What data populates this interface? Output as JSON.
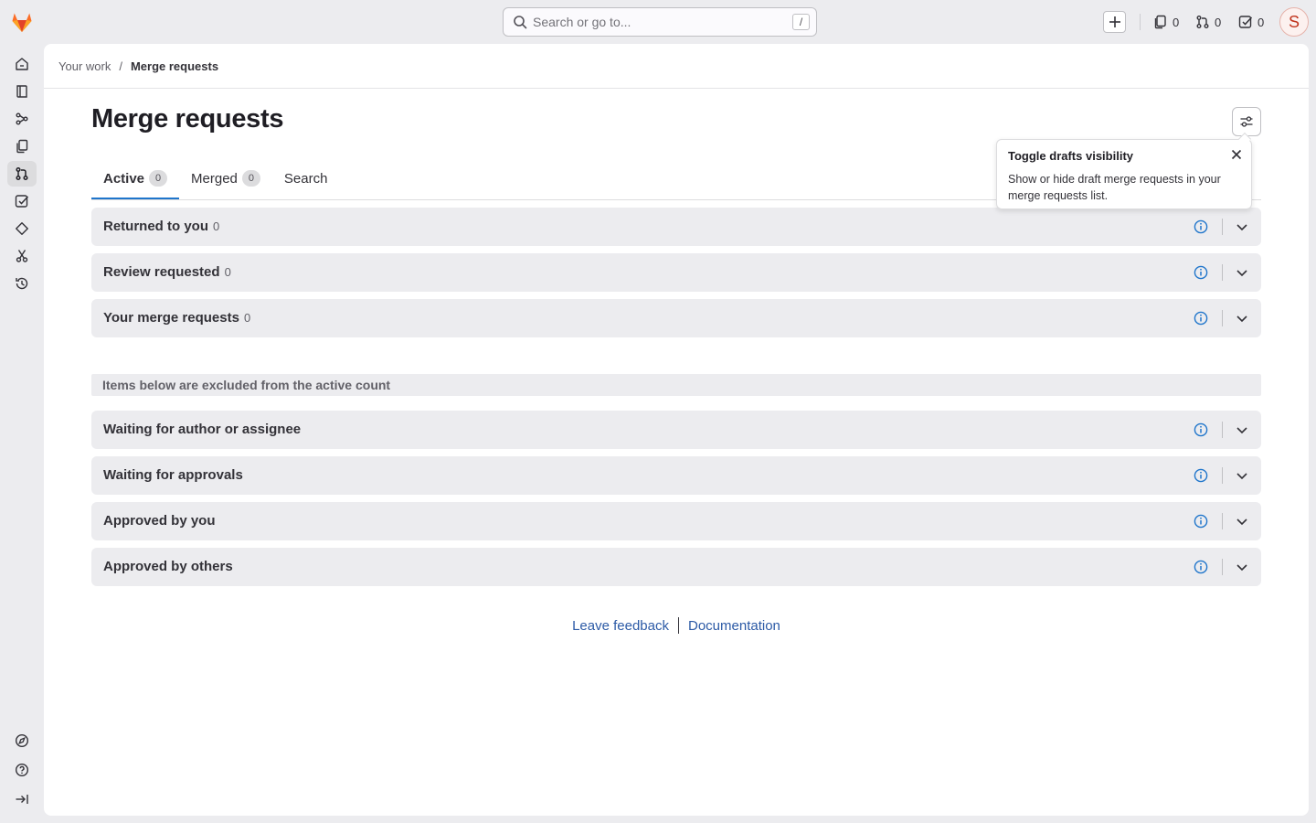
{
  "search": {
    "placeholder": "Search or go to...",
    "shortcut": "/"
  },
  "counters": {
    "issues": "0",
    "merge_requests": "0",
    "todos": "0"
  },
  "avatar": {
    "initial": "S",
    "color": "#c0341d"
  },
  "sidebar": {
    "items": [
      {
        "icon": "home-icon"
      },
      {
        "icon": "issues-icon"
      },
      {
        "icon": "workflow-icon"
      },
      {
        "icon": "snippet-icon"
      },
      {
        "icon": "merge-request-icon",
        "active": true
      },
      {
        "icon": "todo-icon"
      },
      {
        "icon": "milestone-icon"
      },
      {
        "icon": "scissors-icon"
      },
      {
        "icon": "history-icon"
      }
    ],
    "bottom": [
      {
        "icon": "explore-icon"
      },
      {
        "icon": "help-icon"
      },
      {
        "icon": "collapse-icon"
      }
    ]
  },
  "breadcrumb": {
    "parent": "Your work",
    "separator": "/",
    "current": "Merge requests"
  },
  "page": {
    "title": "Merge requests"
  },
  "tabs": [
    {
      "label": "Active",
      "count": "0"
    },
    {
      "label": "Merged",
      "count": "0"
    },
    {
      "label": "Search"
    }
  ],
  "sections": [
    {
      "title": "Returned to you",
      "count": "0"
    },
    {
      "title": "Review requested",
      "count": "0"
    },
    {
      "title": "Your merge requests",
      "count": "0"
    }
  ],
  "excluded_note": "Items below are excluded from the active count",
  "excluded_sections": [
    {
      "title": "Waiting for author or assignee"
    },
    {
      "title": "Waiting for approvals"
    },
    {
      "title": "Approved by you"
    },
    {
      "title": "Approved by others"
    }
  ],
  "footer": {
    "feedback": "Leave feedback",
    "docs": "Documentation"
  },
  "popover": {
    "title": "Toggle drafts visibility",
    "body": "Show or hide draft merge requests in your merge requests list."
  },
  "colors": {
    "accent": "#1f75cb",
    "link": "#2c5aa6",
    "brand": "#fc6d26"
  }
}
